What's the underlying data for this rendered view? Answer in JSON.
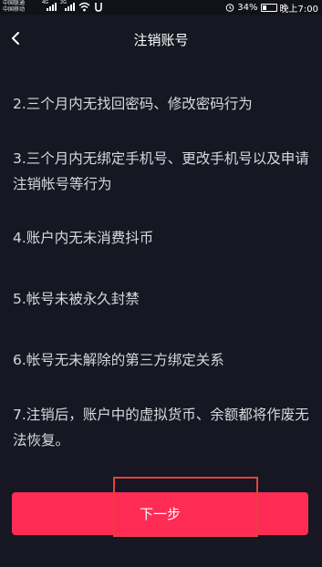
{
  "status_bar": {
    "carrier_1": "中国联通",
    "carrier_1_net": "4G",
    "carrier_2": "中国移动",
    "carrier_2_net": "2G",
    "battery": "34%",
    "battery_level": 0.34,
    "time": "晚上7:00"
  },
  "nav": {
    "back_icon": "chevron-left-icon",
    "title": "注销账号"
  },
  "items": [
    "2.三个月内无找回密码、修改密码行为",
    "3.三个月内无绑定手机号、更改手机号以及申请注销帐号等行为",
    "4.账户内无未消费抖币",
    "5.帐号未被永久封禁",
    "6.帐号无未解除的第三方绑定关系",
    "7.注销后，账户中的虚拟货币、余额都将作废无法恢复。"
  ],
  "footer": {
    "next_label": "下一步"
  },
  "colors": {
    "background": "#161722",
    "accent": "#fe2c55",
    "annotation": "#e8403d"
  }
}
